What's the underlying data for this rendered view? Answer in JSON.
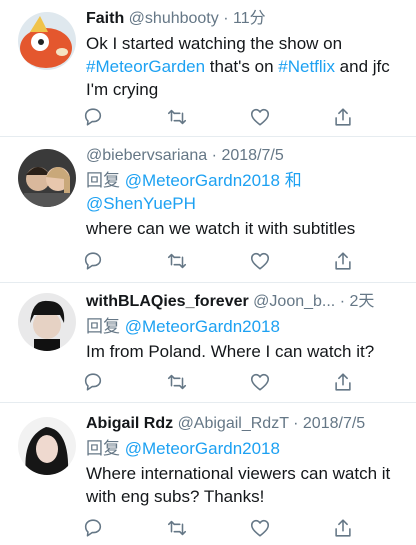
{
  "tweets": [
    {
      "name": "Faith",
      "handle": "@shuhbooty",
      "separator": "·",
      "time": "11分",
      "text_parts": [
        "Ok I started watching the show on ",
        "#MeteorGarden",
        " that's on ",
        "#Netflix",
        " and jfc I'm crying"
      ]
    },
    {
      "name": "",
      "handle": "@biebervsariana",
      "separator": "·",
      "time": "2018/7/5",
      "reply_prefix": "回复",
      "reply_to_1": "@MeteorGardn2018",
      "reply_conj": "和",
      "reply_to_2": "@ShenYuePH",
      "text": "where can we watch it with subtitles"
    },
    {
      "name": "withBLAQies_forever",
      "handle": "@Joon_b...",
      "separator": "·",
      "time": "2天",
      "reply_prefix": "回复",
      "reply_to_1": "@MeteorGardn2018",
      "text": "Im from Poland. Where I can watch it?"
    },
    {
      "name": "Abigail Rdz",
      "handle": "@Abigail_RdzT",
      "separator": "·",
      "time": "2018/7/5",
      "reply_prefix": "回复",
      "reply_to_1": "@MeteorGardn2018",
      "text": "Where international viewers can watch it with eng subs? Thanks!"
    }
  ],
  "icons": [
    "reply-icon",
    "retweet-icon",
    "like-icon",
    "share-icon"
  ],
  "colors": {
    "link": "#1da1f2",
    "muted": "#657786",
    "divider": "#e6ecf0",
    "text": "#14171a"
  }
}
